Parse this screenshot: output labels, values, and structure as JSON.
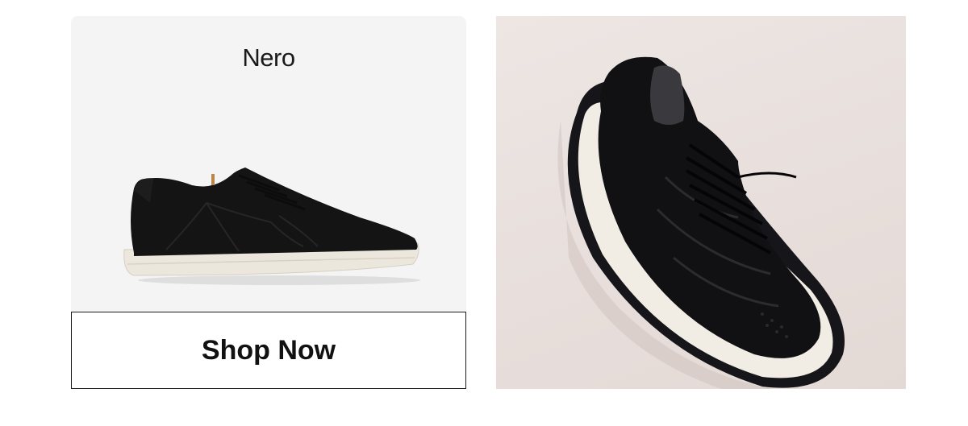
{
  "product": {
    "name": "Nero",
    "cta_label": "Shop Now"
  },
  "colors": {
    "card_background": "#f4f4f4",
    "photo_background": "#e8dfdc",
    "button_border": "#1a1a1a",
    "shoe_upper": "#141414",
    "shoe_sole": "#ece7dc"
  },
  "icons": {
    "product_image": "black-suede-sneaker-side-view",
    "lifestyle_image": "black-leather-sneaker-angled-view"
  }
}
